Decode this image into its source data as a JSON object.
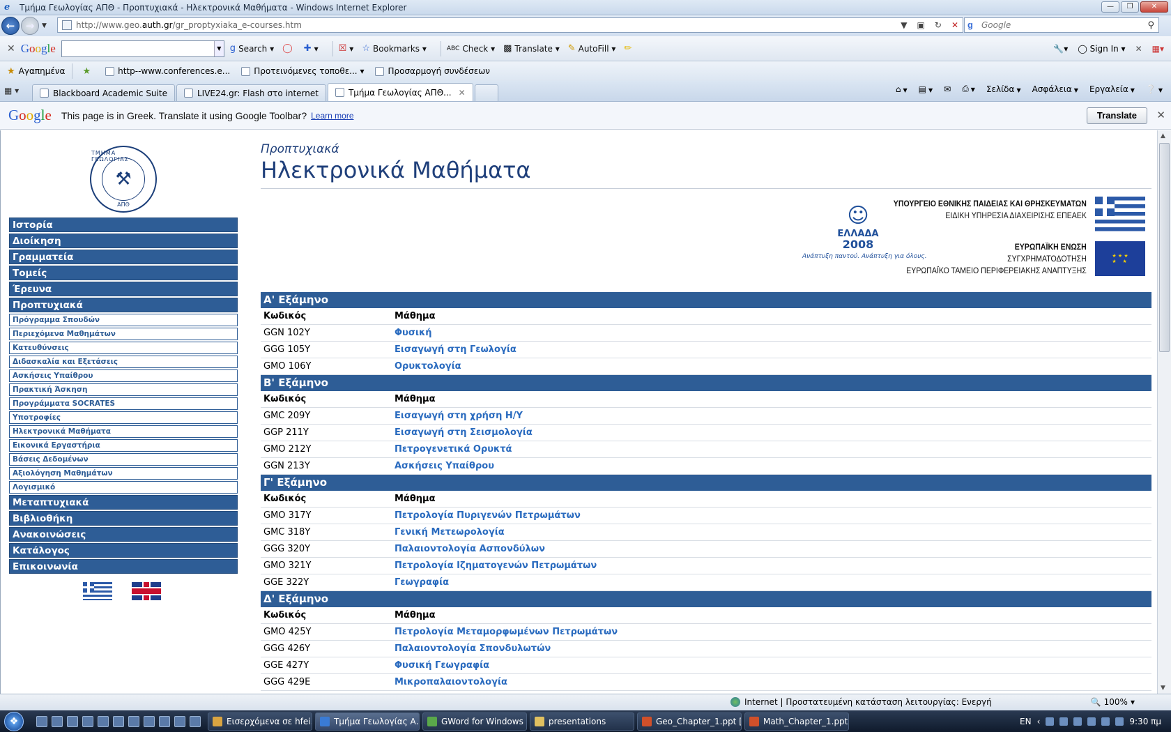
{
  "window": {
    "title": "Τμήμα Γεωλογίας ΑΠΘ - Προπτυχιακά - Ηλεκτρονικά Μαθήματα - Windows Internet Explorer"
  },
  "address": {
    "url_prefix": "http://www.geo.",
    "url_domain": "auth.gr",
    "url_path": "/gr_proptyxiaka_e-courses.htm"
  },
  "search": {
    "placeholder": "Google"
  },
  "google_toolbar": {
    "logo": "Google",
    "items": [
      "Search",
      "Bookmarks",
      "Check",
      "Translate",
      "AutoFill"
    ],
    "sign_in": "Sign In"
  },
  "favorites": {
    "label": "Αγαπημένα",
    "links": [
      "http--www.conferences.e...",
      "Προτεινόμενες τοποθε...",
      "Προσαρμογή συνδέσεων"
    ]
  },
  "tabs": [
    {
      "label": "Blackboard Academic Suite"
    },
    {
      "label": "LIVE24.gr: Flash στο internet"
    },
    {
      "label": "Τμήμα Γεωλογίας ΑΠΘ..."
    }
  ],
  "commands": [
    "Σελίδα",
    "Ασφάλεια",
    "Εργαλεία"
  ],
  "translate_bar": {
    "message": "This page is in Greek.  Translate it using Google Toolbar?",
    "learn_more": "Learn more",
    "button": "Translate"
  },
  "logo": {
    "top": "ΤΜΗΜΑ ΓΕΩΛΟΓΙΑΣ",
    "bottom": "ΑΠΘ"
  },
  "nav": [
    "Ιστορία",
    "Διοίκηση",
    "Γραμματεία",
    "Τομείς",
    "Έρευνα",
    "Προπτυχιακά"
  ],
  "subnav": [
    "Πρόγραμμα Σπουδών",
    "Περιεχόμενα Μαθημάτων",
    "Κατευθύνσεις",
    "Διδασκαλία και Εξετάσεις",
    "Ασκήσεις Υπαίθρου",
    "Πρακτική Άσκηση",
    "Προγράμματα SOCRATES",
    "Υποτροφίες",
    "Ηλεκτρονικά Μαθήματα",
    "Εικονικά Εργαστήρια",
    "Βάσεις Δεδομένων",
    "Αξιολόγηση Μαθημάτων",
    "Λογισμικό"
  ],
  "nav_after": [
    "Μεταπτυχιακά",
    "Βιβλιοθήκη",
    "Ανακοινώσεις",
    "Κατάλογος",
    "Επικοινωνία"
  ],
  "page": {
    "breadcrumb": "Προπτυχιακά",
    "title": "Ηλεκτρονικά Μαθήματα"
  },
  "espa": {
    "line1": "ΥΠΟΥΡΓΕΙΟ ΕΘΝΙΚΗΣ ΠΑΙΔΕΙΑΣ ΚΑΙ ΘΡΗΣΚΕΥΜΑΤΩΝ",
    "line2": "ΕΙΔΙΚΗ ΥΠΗΡΕΣΙΑ ΔΙΑΧΕΙΡΙΣΗΣ ΕΠΕΑΕΚ",
    "line3": "ΕΥΡΩΠΑΪΚΗ ΕΝΩΣΗ",
    "line4": "ΣΥΓΧΡΗΜΑΤΟΔΟΤΗΣΗ",
    "line5": "ΕΥΡΩΠΑΪΚΟ ΤΑΜΕΙΟ ΠΕΡΙΦΕΡΕΙΑΚΗΣ ΑΝΑΠΤΥΞΗΣ",
    "hellas_word": "ΕΛΛΑΔΑ",
    "hellas_year": "2008",
    "hellas_slogan": "Ανάπτυξη παντού.  Ανάπτυξη για όλους."
  },
  "columns": {
    "code": "Κωδικός",
    "course": "Μάθημα"
  },
  "semesters": [
    {
      "title": "Α' Εξάμηνο",
      "courses": [
        {
          "code": "GGN 102Y",
          "name": "Φυσική"
        },
        {
          "code": "GGG 105Y",
          "name": "Εισαγωγή στη Γεωλογία"
        },
        {
          "code": "GMO 106Y",
          "name": "Ορυκτολογία"
        }
      ]
    },
    {
      "title": "Β' Εξάμηνο",
      "courses": [
        {
          "code": "GMC 209Y",
          "name": "Εισαγωγή στη χρήση Η/Υ"
        },
        {
          "code": "GGP 211Y",
          "name": "Εισαγωγή στη Σεισμολογία"
        },
        {
          "code": "GMO 212Y",
          "name": "Πετρογενετικά Ορυκτά"
        },
        {
          "code": "GGN 213Y",
          "name": "Ασκήσεις Υπαίθρου"
        }
      ]
    },
    {
      "title": "Γ' Εξάμηνο",
      "courses": [
        {
          "code": "GMO 317Y",
          "name": "Πετρολογία Πυριγενών Πετρωμάτων"
        },
        {
          "code": "GMC 318Y",
          "name": "Γενική Μετεωρολογία"
        },
        {
          "code": "GGG 320Y",
          "name": "Παλαιοντολογία Ασπονδύλων"
        },
        {
          "code": "GMO 321Y",
          "name": "Πετρολογία Ιζηματογενών Πετρωμάτων"
        },
        {
          "code": "GGE 322Y",
          "name": "Γεωγραφία"
        }
      ]
    },
    {
      "title": "Δ' Εξάμηνο",
      "courses": [
        {
          "code": "GMO 425Y",
          "name": "Πετρολογία Μεταμορφωμένων Πετρωμάτων"
        },
        {
          "code": "GGG 426Y",
          "name": "Παλαιοντολογία Σπονδυλωτών"
        },
        {
          "code": "GGE 427Y",
          "name": "Φυσική Γεωγραφία"
        },
        {
          "code": "GGG 429E",
          "name": "Μικροπαλαιοντολογία"
        }
      ]
    }
  ],
  "status": {
    "zone": "Internet | Προστατευμένη κατάσταση λειτουργίας: Ενεργή",
    "zoom": "100%"
  },
  "taskbar": {
    "tasks": [
      "Εισερχόμενα σε hfei...",
      "Τμήμα Γεωλογίας Α...",
      "GWord for Windows",
      "presentations",
      "Geo_Chapter_1.ppt [...",
      "Math_Chapter_1.ppt..."
    ],
    "lang": "EN",
    "time": "9:30 πμ"
  }
}
